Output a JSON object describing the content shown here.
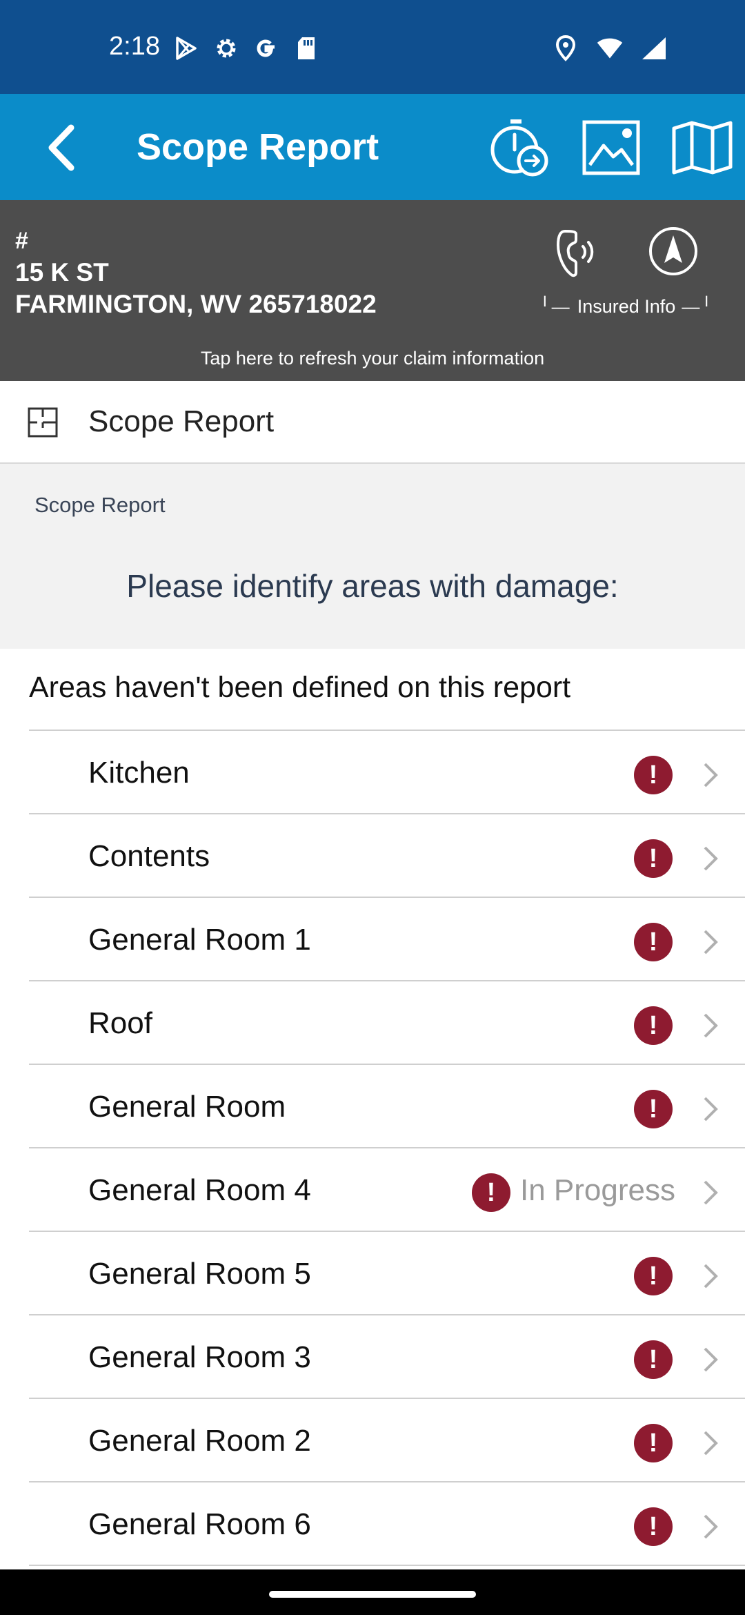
{
  "status_bar": {
    "time": "2:18",
    "left_icons": [
      "play-store-icon",
      "settings-gear-icon",
      "google-icon",
      "sd-card-icon"
    ],
    "right_icons": [
      "location-pin-icon",
      "wifi-icon",
      "cell-signal-icon"
    ]
  },
  "app_bar": {
    "title": "Scope Report",
    "actions": [
      "timer-forward-icon",
      "photo-gallery-icon",
      "map-icon"
    ],
    "background": "#0b8cc9"
  },
  "claim": {
    "number": "#",
    "address_line1": "15 K ST",
    "address_line2": "FARMINGTON, WV 265718022",
    "insured_info_label": "Insured Info",
    "refresh_text": "Tap here to refresh your claim information",
    "background": "#4d4d4d"
  },
  "section": {
    "title": "Scope Report"
  },
  "info_panel": {
    "small_label": "Scope Report",
    "prompt": "Please identify areas with damage:"
  },
  "notice": "Areas haven't been defined on this report",
  "areas": [
    {
      "label": "Kitchen",
      "status": ""
    },
    {
      "label": "Contents",
      "status": ""
    },
    {
      "label": "General Room 1",
      "status": ""
    },
    {
      "label": "Roof",
      "status": ""
    },
    {
      "label": "General Room",
      "status": ""
    },
    {
      "label": "General Room 4",
      "status": "In Progress"
    },
    {
      "label": "General Room 5",
      "status": ""
    },
    {
      "label": "General Room 3",
      "status": ""
    },
    {
      "label": "General Room 2",
      "status": ""
    },
    {
      "label": "General Room 6",
      "status": ""
    }
  ],
  "colors": {
    "status_bar": "#0f4f8f",
    "alert": "#8e1b30"
  }
}
